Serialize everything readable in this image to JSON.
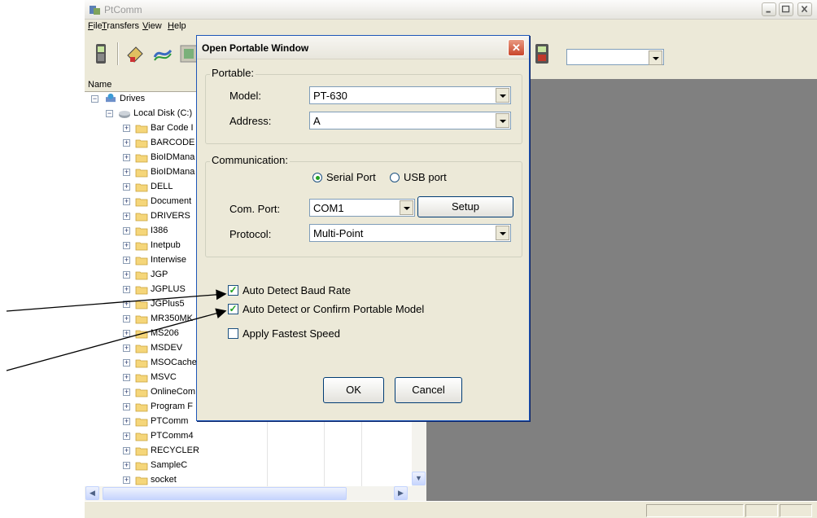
{
  "app": {
    "title": "PtComm",
    "menus": [
      "File",
      "Transfers",
      "View",
      "Help"
    ],
    "menu_underlines": [
      "F",
      "T",
      "V",
      "H"
    ],
    "menu_rests": [
      "ile",
      "ransfers",
      "iew",
      "elp"
    ]
  },
  "tree": {
    "column_header": "Name",
    "root": "Drives",
    "disk": "Local Disk (C:)",
    "folders": [
      "Bar Code I",
      "BARCODE",
      "BioIDMana",
      "BioIDMana",
      "DELL",
      "Document",
      "DRIVERS",
      "I386",
      "Inetpub",
      "Interwise",
      "JGP",
      "JGPLUS",
      "JGPlus5",
      "MR350MK",
      "MS206",
      "MSDEV",
      "MSOCache",
      "MSVC",
      "OnlineCom",
      "Program F",
      "PTComm",
      "PTComm4",
      "RECYCLER",
      "SampleC",
      "socket"
    ]
  },
  "dialog": {
    "title": "Open Portable Window",
    "close_glyph": "✕",
    "portable": {
      "legend": "Portable:",
      "model_label": "Model:",
      "model_value": "PT-630",
      "address_label": "Address:",
      "address_value": "A"
    },
    "communication": {
      "legend": "Communication:",
      "serial_label": "Serial Port",
      "usb_label": "USB port",
      "selected": "Serial Port",
      "comport_label": "Com. Port:",
      "comport_value": "COM1",
      "setup_label": "Setup",
      "protocol_label": "Protocol:",
      "protocol_value": "Multi-Point"
    },
    "options": [
      {
        "label": "Auto Detect Baud Rate",
        "checked": true
      },
      {
        "label": "Auto Detect or Confirm Portable Model",
        "checked": true
      },
      {
        "label": "Apply Fastest Speed",
        "checked": false
      }
    ],
    "check_glyph": "✓",
    "ok_label": "OK",
    "cancel_label": "Cancel"
  }
}
